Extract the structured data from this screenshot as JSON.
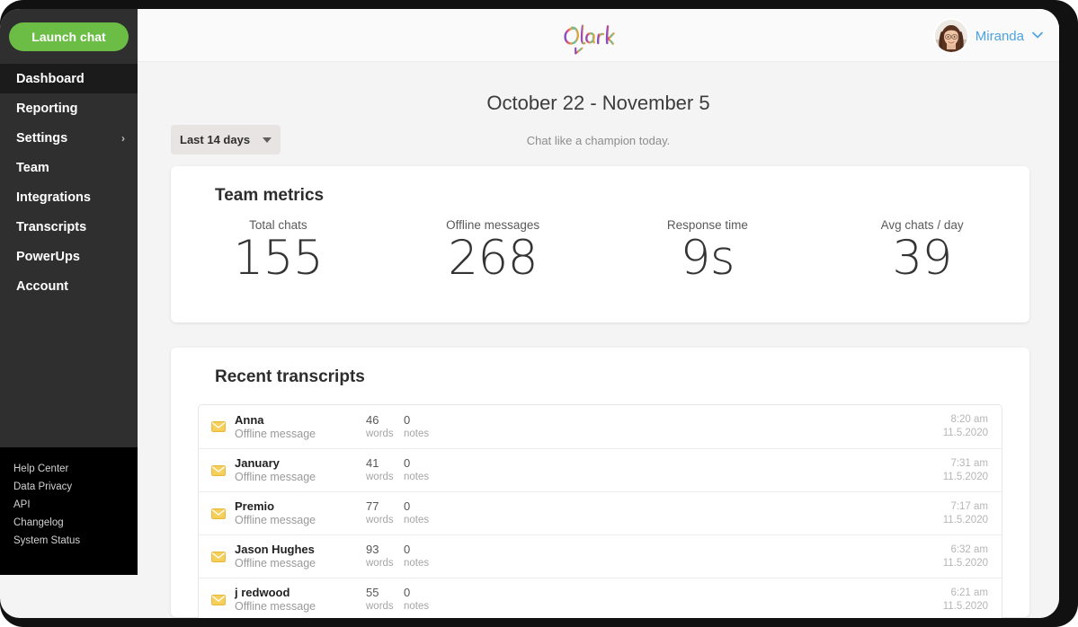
{
  "sidebar": {
    "launch_chat_label": "Launch chat",
    "items": [
      {
        "label": "Dashboard",
        "active": true,
        "chevron": ""
      },
      {
        "label": "Reporting",
        "active": false,
        "chevron": ""
      },
      {
        "label": "Settings",
        "active": false,
        "chevron": "›"
      },
      {
        "label": "Team",
        "active": false,
        "chevron": ""
      },
      {
        "label": "Integrations",
        "active": false,
        "chevron": ""
      },
      {
        "label": "Transcripts",
        "active": false,
        "chevron": ""
      },
      {
        "label": "PowerUps",
        "active": false,
        "chevron": ""
      },
      {
        "label": "Account",
        "active": false,
        "chevron": ""
      }
    ],
    "footer_links": [
      {
        "label": "Help Center"
      },
      {
        "label": "Data Privacy"
      },
      {
        "label": "API"
      },
      {
        "label": "Changelog"
      },
      {
        "label": "System Status"
      }
    ]
  },
  "header": {
    "logo_text": "Olark",
    "logo_icon": "olark-logo",
    "user_name": "Miranda",
    "user_chevron": "∨",
    "avatar_icon": "user-avatar"
  },
  "page": {
    "date_range_title": "October 22 - November 5",
    "tagline": "Chat like a champion today.",
    "range_select_value": "Last 14 days"
  },
  "metrics": {
    "title": "Team metrics",
    "items": [
      {
        "label": "Total chats",
        "value": "155"
      },
      {
        "label": "Offline messages",
        "value": "268"
      },
      {
        "label": "Response time",
        "value": "9s"
      },
      {
        "label": "Avg chats / day",
        "value": "39"
      }
    ]
  },
  "transcripts": {
    "title": "Recent transcripts",
    "rows": [
      {
        "icon": "envelope-icon",
        "name": "Anna",
        "subtitle": "Offline message",
        "words": "46",
        "words_unit": "words",
        "notes": "0",
        "notes_unit": "notes",
        "time": "8:20 am",
        "date": "11.5.2020"
      },
      {
        "icon": "envelope-icon",
        "name": "January",
        "subtitle": "Offline message",
        "words": "41",
        "words_unit": "words",
        "notes": "0",
        "notes_unit": "notes",
        "time": "7:31 am",
        "date": "11.5.2020"
      },
      {
        "icon": "envelope-icon",
        "name": "Premio",
        "subtitle": "Offline message",
        "words": "77",
        "words_unit": "words",
        "notes": "0",
        "notes_unit": "notes",
        "time": "7:17 am",
        "date": "11.5.2020"
      },
      {
        "icon": "envelope-icon",
        "name": "Jason Hughes",
        "subtitle": "Offline message",
        "words": "93",
        "words_unit": "words",
        "notes": "0",
        "notes_unit": "notes",
        "time": "6:32 am",
        "date": "11.5.2020"
      },
      {
        "icon": "envelope-icon",
        "name": "j redwood",
        "subtitle": "Offline message",
        "words": "55",
        "words_unit": "words",
        "notes": "0",
        "notes_unit": "notes",
        "time": "6:21 am",
        "date": "11.5.2020"
      }
    ]
  },
  "colors": {
    "launch_chat_green": "#6cbd45",
    "sidebar_dark": "#2f2f2f",
    "sidebar_active": "#1b1b1b",
    "sidebar_footer": "#000000",
    "user_name_blue": "#4da3de",
    "envelope_gold": "#f2c council"
  }
}
